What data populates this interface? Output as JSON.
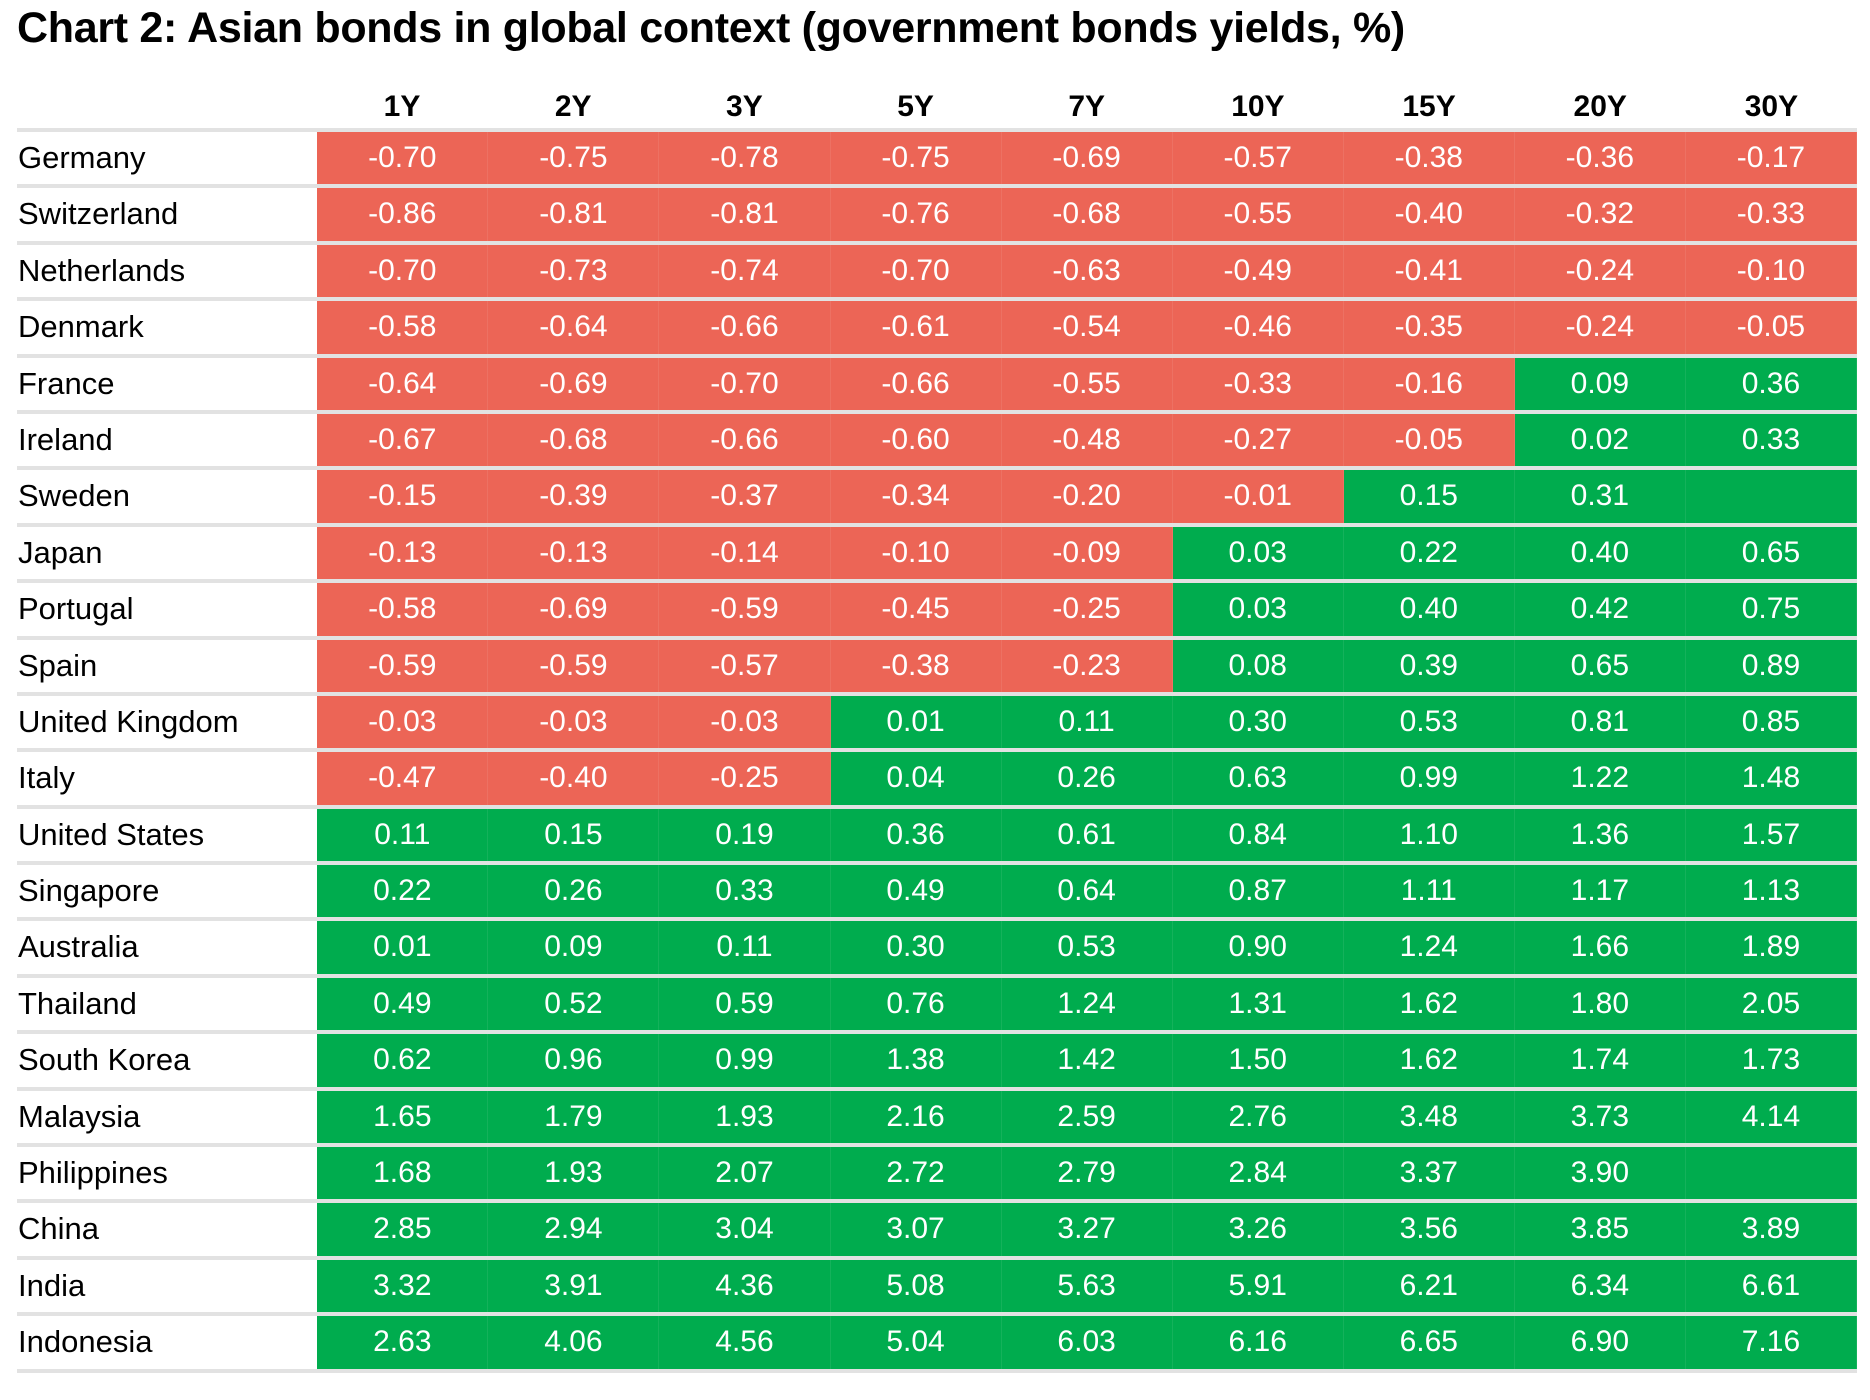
{
  "chart_data": {
    "type": "table",
    "title": "Chart 2: Asian bonds in global context (government bonds yields, %)",
    "columns": [
      "1Y",
      "2Y",
      "3Y",
      "5Y",
      "7Y",
      "10Y",
      "15Y",
      "20Y",
      "30Y"
    ],
    "colors": {
      "negative": "#EC6556",
      "positive": "#00AC4E"
    },
    "rows": [
      {
        "country": "Germany",
        "values": [
          "-0.70",
          "-0.75",
          "-0.78",
          "-0.75",
          "-0.69",
          "-0.57",
          "-0.38",
          "-0.36",
          "-0.17"
        ]
      },
      {
        "country": "Switzerland",
        "values": [
          "-0.86",
          "-0.81",
          "-0.81",
          "-0.76",
          "-0.68",
          "-0.55",
          "-0.40",
          "-0.32",
          "-0.33"
        ]
      },
      {
        "country": "Netherlands",
        "values": [
          "-0.70",
          "-0.73",
          "-0.74",
          "-0.70",
          "-0.63",
          "-0.49",
          "-0.41",
          "-0.24",
          "-0.10"
        ]
      },
      {
        "country": "Denmark",
        "values": [
          "-0.58",
          "-0.64",
          "-0.66",
          "-0.61",
          "-0.54",
          "-0.46",
          "-0.35",
          "-0.24",
          "-0.05"
        ]
      },
      {
        "country": "France",
        "values": [
          "-0.64",
          "-0.69",
          "-0.70",
          "-0.66",
          "-0.55",
          "-0.33",
          "-0.16",
          "0.09",
          "0.36"
        ]
      },
      {
        "country": "Ireland",
        "values": [
          "-0.67",
          "-0.68",
          "-0.66",
          "-0.60",
          "-0.48",
          "-0.27",
          "-0.05",
          "0.02",
          "0.33"
        ]
      },
      {
        "country": "Sweden",
        "values": [
          "-0.15",
          "-0.39",
          "-0.37",
          "-0.34",
          "-0.20",
          "-0.01",
          "0.15",
          "0.31",
          ""
        ]
      },
      {
        "country": "Japan",
        "values": [
          "-0.13",
          "-0.13",
          "-0.14",
          "-0.10",
          "-0.09",
          "0.03",
          "0.22",
          "0.40",
          "0.65"
        ]
      },
      {
        "country": "Portugal",
        "values": [
          "-0.58",
          "-0.69",
          "-0.59",
          "-0.45",
          "-0.25",
          "0.03",
          "0.40",
          "0.42",
          "0.75"
        ]
      },
      {
        "country": "Spain",
        "values": [
          "-0.59",
          "-0.59",
          "-0.57",
          "-0.38",
          "-0.23",
          "0.08",
          "0.39",
          "0.65",
          "0.89"
        ]
      },
      {
        "country": "United Kingdom",
        "values": [
          "-0.03",
          "-0.03",
          "-0.03",
          "0.01",
          "0.11",
          "0.30",
          "0.53",
          "0.81",
          "0.85"
        ]
      },
      {
        "country": "Italy",
        "values": [
          "-0.47",
          "-0.40",
          "-0.25",
          "0.04",
          "0.26",
          "0.63",
          "0.99",
          "1.22",
          "1.48"
        ]
      },
      {
        "country": "United States",
        "values": [
          "0.11",
          "0.15",
          "0.19",
          "0.36",
          "0.61",
          "0.84",
          "1.10",
          "1.36",
          "1.57"
        ]
      },
      {
        "country": "Singapore",
        "values": [
          "0.22",
          "0.26",
          "0.33",
          "0.49",
          "0.64",
          "0.87",
          "1.11",
          "1.17",
          "1.13"
        ]
      },
      {
        "country": "Australia",
        "values": [
          "0.01",
          "0.09",
          "0.11",
          "0.30",
          "0.53",
          "0.90",
          "1.24",
          "1.66",
          "1.89"
        ]
      },
      {
        "country": "Thailand",
        "values": [
          "0.49",
          "0.52",
          "0.59",
          "0.76",
          "1.24",
          "1.31",
          "1.62",
          "1.80",
          "2.05"
        ]
      },
      {
        "country": "South Korea",
        "values": [
          "0.62",
          "0.96",
          "0.99",
          "1.38",
          "1.42",
          "1.50",
          "1.62",
          "1.74",
          "1.73"
        ]
      },
      {
        "country": "Malaysia",
        "values": [
          "1.65",
          "1.79",
          "1.93",
          "2.16",
          "2.59",
          "2.76",
          "3.48",
          "3.73",
          "4.14"
        ]
      },
      {
        "country": "Philippines",
        "values": [
          "1.68",
          "1.93",
          "2.07",
          "2.72",
          "2.79",
          "2.84",
          "3.37",
          "3.90",
          ""
        ]
      },
      {
        "country": "China",
        "values": [
          "2.85",
          "2.94",
          "3.04",
          "3.07",
          "3.27",
          "3.26",
          "3.56",
          "3.85",
          "3.89"
        ]
      },
      {
        "country": "India",
        "values": [
          "3.32",
          "3.91",
          "4.36",
          "5.08",
          "5.63",
          "5.91",
          "6.21",
          "6.34",
          "6.61"
        ]
      },
      {
        "country": "Indonesia",
        "values": [
          "2.63",
          "4.06",
          "4.56",
          "5.04",
          "6.03",
          "6.16",
          "6.65",
          "6.90",
          "7.16"
        ]
      }
    ]
  }
}
